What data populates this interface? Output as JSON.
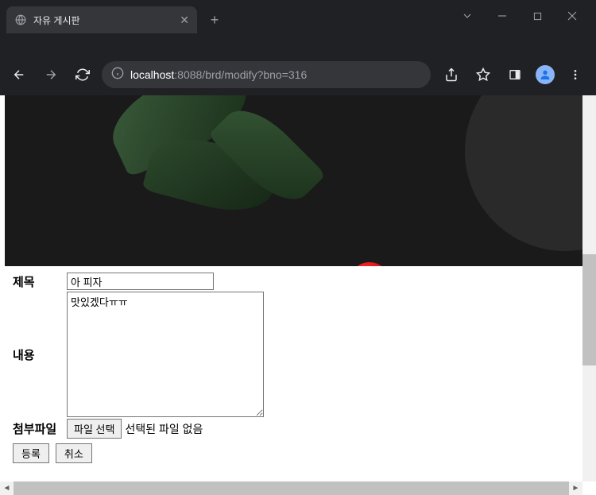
{
  "browser": {
    "tab": {
      "title": "자유 게시판"
    },
    "url": {
      "host": "localhost",
      "rest": ":8088/brd/modify?bno=316"
    }
  },
  "form": {
    "title_label": "제목",
    "title_value": "아 피자",
    "content_label": "내용",
    "content_value": "맛있겠다ㅠㅠ",
    "attachment_label": "첨부파일",
    "file_button_label": "파일 선택",
    "file_status": "선택된 파일 없음",
    "submit_label": "등록",
    "cancel_label": "취소"
  }
}
